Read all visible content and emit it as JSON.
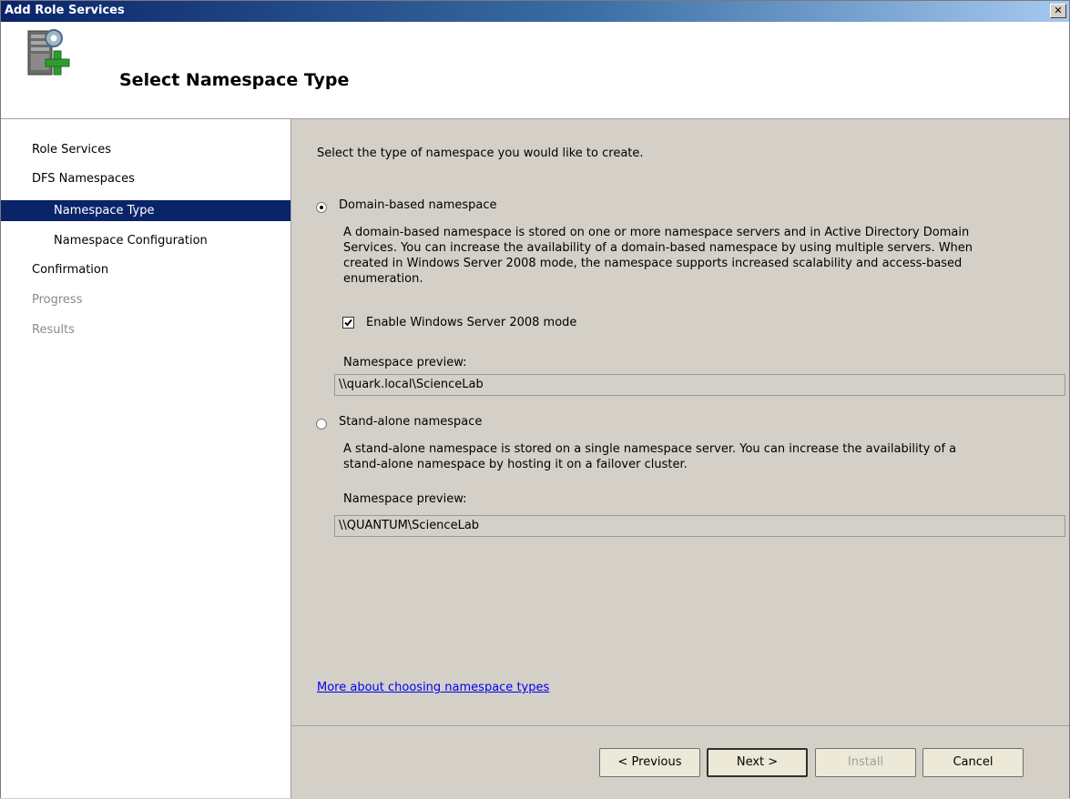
{
  "window": {
    "title": "Add Role Services",
    "close_glyph": "✕"
  },
  "header": {
    "title": "Select Namespace Type",
    "icon": "server-add-icon"
  },
  "sidebar": {
    "items": [
      {
        "label": "Role Services",
        "level": 1,
        "state": "normal"
      },
      {
        "label": "DFS Namespaces",
        "level": 1,
        "state": "normal"
      },
      {
        "label": "Namespace Type",
        "level": 2,
        "state": "selected"
      },
      {
        "label": "Namespace Configuration",
        "level": 2,
        "state": "normal"
      },
      {
        "label": "Confirmation",
        "level": 1,
        "state": "normal"
      },
      {
        "label": "Progress",
        "level": 1,
        "state": "disabled"
      },
      {
        "label": "Results",
        "level": 1,
        "state": "disabled"
      }
    ]
  },
  "main": {
    "instruction": "Select the type of namespace you would like to create.",
    "domain": {
      "label": "Domain-based namespace",
      "selected": true,
      "description_lines": [
        "A domain-based namespace is stored on one or more namespace servers and in Active Directory Domain",
        "Services. You can increase the availability of a domain-based namespace by using multiple servers. When",
        "created in Windows Server 2008 mode, the namespace supports increased scalability and access-based",
        "enumeration."
      ],
      "mode_checkbox_label": "Enable Windows Server 2008 mode",
      "mode_checked": true,
      "preview_label": "Namespace preview:",
      "preview_value": "\\\\quark.local\\ScienceLab"
    },
    "standalone": {
      "label": "Stand-alone namespace",
      "selected": false,
      "description_lines": [
        "A stand-alone namespace is stored on a single namespace server. You can increase the availability of a",
        "stand-alone namespace by hosting it on a failover cluster."
      ],
      "preview_label": "Namespace preview:",
      "preview_value": "\\\\QUANTUM\\ScienceLab"
    },
    "more_link": "More about choosing namespace types"
  },
  "footer": {
    "previous_label": "< Previous",
    "next_label": "Next >",
    "install_label": "Install",
    "cancel_label": "Cancel",
    "install_enabled": false
  },
  "colors": {
    "selected_bg": "#0a246a",
    "title_bar": "#0a246a",
    "dialog_bg": "#d4d0c8",
    "link": "#0000ee"
  }
}
